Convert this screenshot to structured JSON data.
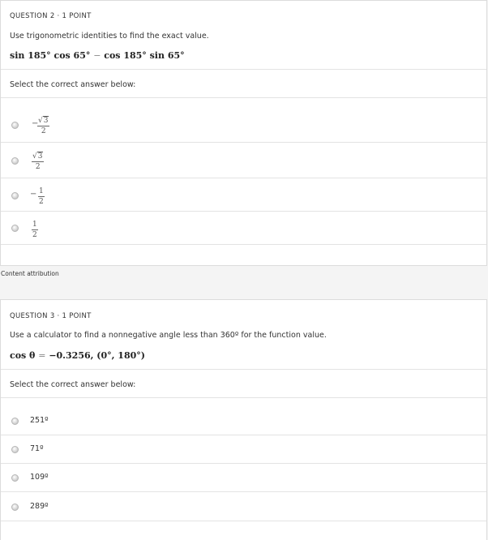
{
  "question2": {
    "header": "QUESTION 2 · 1 POINT",
    "prompt": "Use trigonometric identities to find the exact value.",
    "expression": {
      "part1": "sin 185° cos 65°",
      "operator": "−",
      "part2": "cos 185° sin 65°"
    },
    "select_label": "Select the correct answer below:",
    "options": [
      {
        "sign": "−",
        "num": "3",
        "num_has_sqrt": true,
        "den": "2"
      },
      {
        "sign": "",
        "num": "3",
        "num_has_sqrt": true,
        "den": "2"
      },
      {
        "sign": "−",
        "num": "1",
        "num_has_sqrt": false,
        "den": "2"
      },
      {
        "sign": "",
        "num": "1",
        "num_has_sqrt": false,
        "den": "2"
      }
    ]
  },
  "attribution": "Content attribution",
  "question3": {
    "header": "QUESTION 3 · 1 POINT",
    "prompt": "Use a calculator to find a nonnegative angle less than 360º for the function value.",
    "expression": {
      "lhs": "cos θ",
      "operator": "=",
      "rhs": "−0.3256,  (0°, 180°)"
    },
    "select_label": "Select the correct answer below:",
    "options": [
      "251º",
      "71º",
      "109º",
      "289º"
    ]
  }
}
